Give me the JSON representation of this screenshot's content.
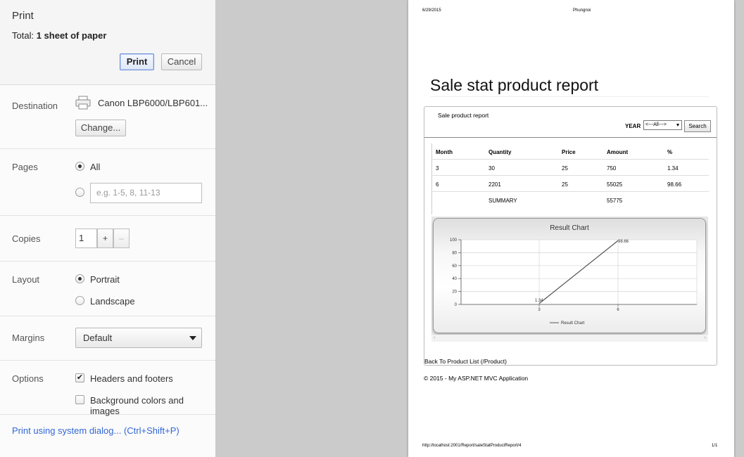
{
  "sidebar": {
    "title": "Print",
    "total_label": "Total:",
    "total_value": "1 sheet of paper",
    "print_button": "Print",
    "cancel_button": "Cancel",
    "destination": {
      "label": "Destination",
      "printer_name": "Canon LBP6000/LBP601...",
      "change_button": "Change..."
    },
    "pages": {
      "label": "Pages",
      "all_label": "All",
      "all_selected": true,
      "custom_placeholder": "e.g. 1-5, 8, 11-13"
    },
    "copies": {
      "label": "Copies",
      "value": "1",
      "increment": "+",
      "decrement": "–"
    },
    "layout": {
      "label": "Layout",
      "portrait": "Portrait",
      "landscape": "Landscape",
      "selected": "Portrait"
    },
    "margins": {
      "label": "Margins",
      "value": "Default"
    },
    "options": {
      "label": "Options",
      "headers_footers": "Headers and footers",
      "headers_footers_checked": true,
      "background": "Background colors and images",
      "background_checked": false
    },
    "system_dialog": "Print using system dialog... (Ctrl+Shift+P)"
  },
  "preview": {
    "header_date": "6/29/2015",
    "header_title": "Phungnoi",
    "footer_url": "http://localhost:2001/Report/saleStatProductReport/4",
    "footer_page": "1/1",
    "report_title": "Sale stat product report",
    "panel_title": "Sale product report",
    "year_label": "YEAR",
    "year_value": "<---All--->",
    "search_button": "Search",
    "table": {
      "headers": [
        "Month",
        "Quantity",
        "Price",
        "Amount",
        "%"
      ],
      "rows": [
        [
          "3",
          "30",
          "25",
          "750",
          "1.34"
        ],
        [
          "6",
          "2201",
          "25",
          "55025",
          "98.66"
        ],
        [
          "",
          "SUMMARY",
          "",
          "55775",
          ""
        ]
      ]
    },
    "back_link": "Back To Product List (/Product)",
    "copyright": "© 2015 - My ASP.NET MVC Application",
    "scroll_left": "‹",
    "scroll_right": "›"
  },
  "chart_data": {
    "type": "line",
    "title": "Result Chart",
    "categories": [
      "3",
      "6"
    ],
    "series": [
      {
        "name": "Result Chart",
        "values": [
          1.34,
          98.66
        ],
        "labels": [
          "1.34",
          "98.66"
        ],
        "color": "#555555"
      }
    ],
    "ylim": [
      0,
      100
    ],
    "yticks": [
      "0",
      "20",
      "40",
      "60",
      "80",
      "100"
    ],
    "grid": true,
    "legend": "bottom"
  },
  "colors": {
    "link": "#3367d6",
    "print_border": "#6a8ed8",
    "preview_bg": "#cbcbcb"
  }
}
